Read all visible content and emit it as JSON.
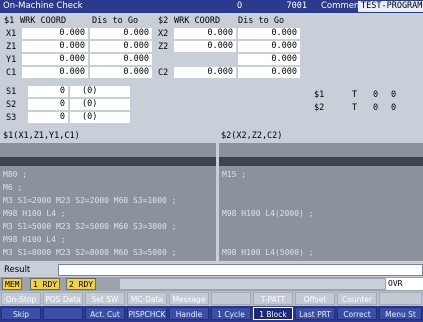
{
  "header": {
    "title": "On-Machine Check",
    "program_o": "O",
    "program_number": "7001",
    "comment_label": "Comment",
    "comment_value": "TEST-PROGRAM"
  },
  "coords": {
    "left": {
      "sys_label": "$1",
      "coord_header": "WRK COORD",
      "dtg_header": "Dis to Go",
      "rows": [
        {
          "axis": "X1",
          "coord": "0.000",
          "dtg": "0.000"
        },
        {
          "axis": "Z1",
          "coord": "0.000",
          "dtg": "0.000"
        },
        {
          "axis": "Y1",
          "coord": "0.000",
          "dtg": "0.000"
        },
        {
          "axis": "C1",
          "coord": "0.000",
          "dtg": "0.000"
        }
      ]
    },
    "right": {
      "sys_label": "$2",
      "coord_header": "WRK COORD",
      "dtg_header": "Dis to Go",
      "rows": [
        {
          "axis": "X2",
          "coord": "0.000",
          "dtg": "0.000"
        },
        {
          "axis": "Z2",
          "coord": "0.000",
          "dtg": "0.000"
        },
        {
          "axis": "",
          "coord": "",
          "dtg": "0.000"
        },
        {
          "axis": "C2",
          "coord": "0.000",
          "dtg": "0.000"
        }
      ]
    }
  },
  "spindles": [
    {
      "label": "S1",
      "value": "0",
      "paren": "(0)"
    },
    {
      "label": "S2",
      "value": "0",
      "paren": "(0)"
    },
    {
      "label": "S3",
      "value": "0",
      "paren": "(0)"
    }
  ],
  "tools": [
    {
      "sys": "$1",
      "t": "T",
      "a": "0",
      "b": "0"
    },
    {
      "sys": "$2",
      "t": "T",
      "a": "0",
      "b": "0"
    }
  ],
  "programs": {
    "left": {
      "title": "$1(X1,Z1,Y1,C1)",
      "lines": [
        "M80 ;",
        "M6 ;",
        "M3 S1=2000 M23 S2=2000 M60 S3=1000 ;",
        "M98 H100 L4 ;",
        "M3 S1=5000 M23 S2=5000 M60 S3=3000 ;",
        "M98 H100 L4 ;",
        "M3 S1=8000 M23 S2=8000 M60 S3=5000 ;"
      ]
    },
    "right": {
      "title": "$2(X2,Z2,C2)",
      "lines": [
        "M15 ;",
        "",
        "",
        "M98 H100 L4(2000) ;",
        "",
        "",
        "M98 H100 L4(5000) ;"
      ]
    }
  },
  "result": {
    "label": "Result",
    "value": ""
  },
  "status": {
    "badges": [
      "MEM",
      "1 RDY",
      "2 RDY"
    ],
    "ovr": "OVR 100%"
  },
  "softkeys_top": [
    "On-Stop",
    "POS Data",
    "Set SW",
    "MC-Data",
    "Message",
    "",
    "T-PATT",
    "Offset",
    "Counter",
    ""
  ],
  "softkeys_bottom": [
    "Skip",
    "",
    "Act. Cut",
    "PISPCHCK",
    "Handle",
    "1 Cycle",
    "1 Block",
    "Last PRT",
    "Correct",
    "Menu St"
  ],
  "softkeys_bottom_active": "1 Block",
  "colors": {
    "titlebar": "#2a3a8c",
    "panel": "#c8cfd9",
    "badge_yellow": "#f2d23c",
    "softkey_blue": "#3a4ea8"
  }
}
